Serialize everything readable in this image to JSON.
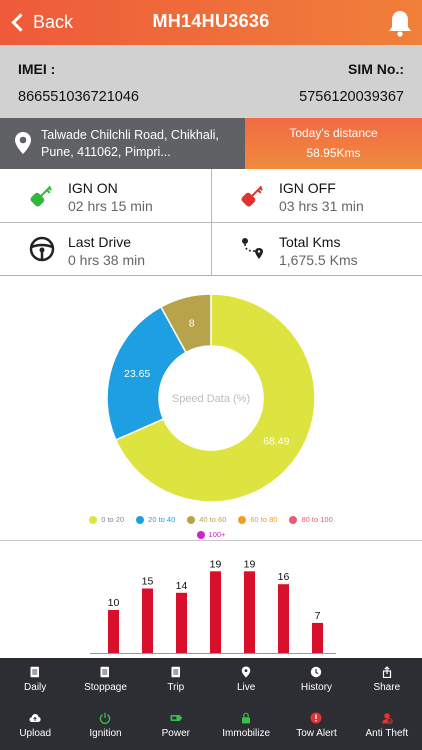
{
  "header": {
    "back_label": "Back",
    "vehicle_number": "MH14HU3636"
  },
  "device": {
    "imei_label": "IMEI :",
    "imei_value": "866551036721046",
    "sim_label": "SIM No.:",
    "sim_value": "5756120039367"
  },
  "location": {
    "address": "Talwade Chilchli Road, Chikhali, Pune, 411062, Pimpri..."
  },
  "distance": {
    "label": "Today's distance",
    "value": "58.95Kms"
  },
  "stats": {
    "ign_on": {
      "title": "IGN ON",
      "value": "02 hrs 15 min",
      "icon": "key-green-icon"
    },
    "ign_off": {
      "title": "IGN OFF",
      "value": "03 hrs 31 min",
      "icon": "key-red-icon"
    },
    "last_drive": {
      "title": "Last Drive",
      "value": "0 hrs 38 min",
      "icon": "steering-wheel-icon"
    },
    "total_kms": {
      "title": "Total Kms",
      "value": "1,675.5 Kms",
      "icon": "route-icon"
    }
  },
  "chart_data": [
    {
      "type": "pie",
      "title": "Speed Data (%)",
      "series": [
        {
          "name": "0 to 20",
          "value": 68.49,
          "color": "#dde33f"
        },
        {
          "name": "20 to 40",
          "value": 23.65,
          "color": "#1e9fe2"
        },
        {
          "name": "40 to 60",
          "value": 8,
          "color": "#b7a34a"
        },
        {
          "name": "60 to 80",
          "value": 0,
          "color": "#f0a020"
        },
        {
          "name": "80 to 100",
          "value": 0,
          "color": "#ee5a73"
        },
        {
          "name": "100+",
          "value": 0,
          "color": "#d21fc8"
        }
      ],
      "legend": "bottom"
    },
    {
      "type": "bar",
      "values": [
        10,
        15,
        14,
        19,
        19,
        16,
        7
      ],
      "color": "#d8102c",
      "ylim": [
        0,
        20
      ]
    }
  ],
  "bottom_nav": {
    "row1": [
      {
        "label": "Daily",
        "icon": "daily-icon"
      },
      {
        "label": "Stoppage",
        "icon": "stoppage-icon"
      },
      {
        "label": "Trip",
        "icon": "trip-icon"
      },
      {
        "label": "Live",
        "icon": "live-icon"
      },
      {
        "label": "History",
        "icon": "history-icon"
      },
      {
        "label": "Share",
        "icon": "share-icon"
      }
    ],
    "row2": [
      {
        "label": "Upload",
        "icon": "upload-icon"
      },
      {
        "label": "Ignition",
        "icon": "ignition-icon"
      },
      {
        "label": "Power",
        "icon": "power-icon"
      },
      {
        "label": "Immobilize",
        "icon": "immobilize-icon"
      },
      {
        "label": "Tow Alert",
        "icon": "tow-alert-icon"
      },
      {
        "label": "Anti Theft",
        "icon": "anti-theft-icon"
      }
    ]
  }
}
